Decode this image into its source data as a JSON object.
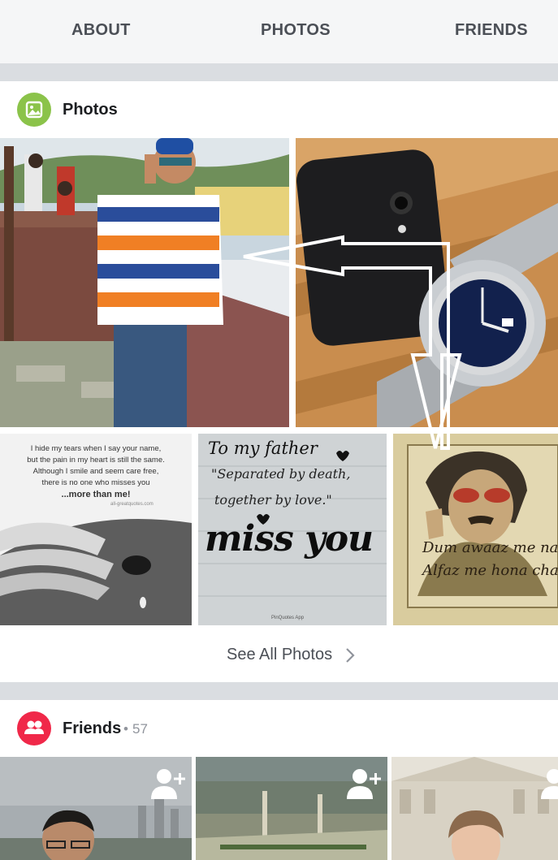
{
  "tabs": [
    {
      "label": "ABOUT"
    },
    {
      "label": "PHOTOS"
    },
    {
      "label": "FRIENDS"
    }
  ],
  "photos_section": {
    "title": "Photos",
    "icon": "photo-album-icon",
    "icon_color": "#8bc34a",
    "see_all_label": "See All Photos",
    "tiles": [
      {
        "name": "photo-man-on-terrace"
      },
      {
        "name": "photo-phone-and-watch"
      },
      {
        "name": "photo-quote-tears",
        "lines": [
          "I hide my tears when I say your name,",
          "but the pain in my heart is still the same.",
          "Although I smile and seem care free,",
          "there is no one who misses you",
          "...more than me!"
        ],
        "credit": "all-greatquotes.com"
      },
      {
        "name": "photo-quote-father",
        "lines": [
          "To my father",
          "\"Separated by death,",
          "together by love.\"",
          "miss you"
        ],
        "credit": "PinQuotes App"
      },
      {
        "name": "photo-quote-sketch",
        "lines": [
          "Dum awaaz me nahi",
          "Alfaz me hona chahye"
        ]
      }
    ]
  },
  "friends_section": {
    "title": "Friends",
    "count_text": "57",
    "icon": "friends-icon",
    "icon_color": "#f02849",
    "tiles": [
      {
        "name": "friend-tile-1"
      },
      {
        "name": "friend-tile-2"
      },
      {
        "name": "friend-tile-3"
      }
    ]
  },
  "colors": {
    "tab_bar_bg": "#f5f6f7",
    "separator": "#dadde1",
    "secondary_text": "#90949c"
  }
}
